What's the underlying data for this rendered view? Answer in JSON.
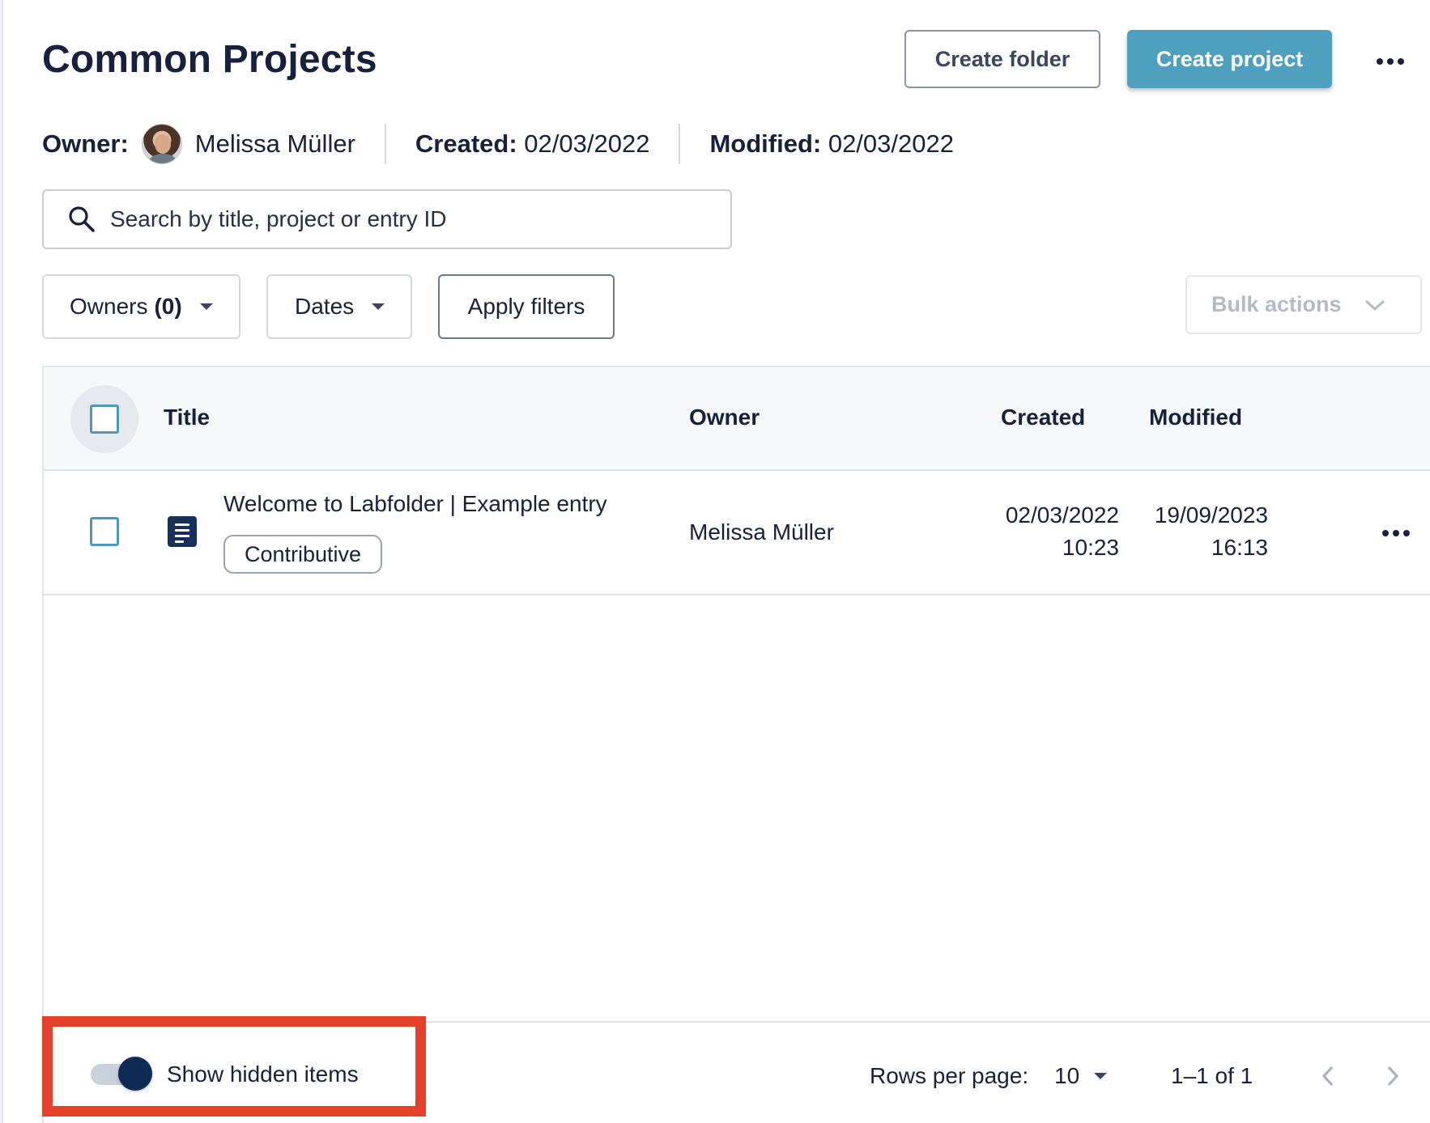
{
  "header": {
    "title": "Common Projects",
    "create_folder_label": "Create folder",
    "create_project_label": "Create project",
    "more_icon": "more-horizontal-icon",
    "accent_color": "#4fa0bf"
  },
  "meta": {
    "owner_label": "Owner:",
    "owner_name": "Melissa Müller",
    "created_label": "Created:",
    "created_value": "02/03/2022",
    "modified_label": "Modified:",
    "modified_value": "02/03/2022"
  },
  "search": {
    "placeholder": "Search by title, project or entry ID",
    "icon": "search-icon"
  },
  "filters": {
    "owners_label": "Owners",
    "owners_count": "(0)",
    "dates_label": "Dates",
    "apply_label": "Apply filters",
    "bulk_label": "Bulk actions"
  },
  "table": {
    "columns": [
      "Title",
      "Owner",
      "Created",
      "Modified"
    ],
    "rows": [
      {
        "title": "Welcome to Labfolder | Example entry",
        "tag": "Contributive",
        "owner": "Melissa Müller",
        "created_date": "02/03/2022",
        "created_time": "10:23",
        "modified_date": "19/09/2023",
        "modified_time": "16:13",
        "icon": "document-icon"
      }
    ]
  },
  "footer": {
    "toggle_label": "Show hidden items",
    "toggle_on": true,
    "rows_per_page_label": "Rows per page:",
    "rows_per_page_value": "10",
    "range_text": "1–1 of 1"
  },
  "highlight_color": "#e5412a"
}
